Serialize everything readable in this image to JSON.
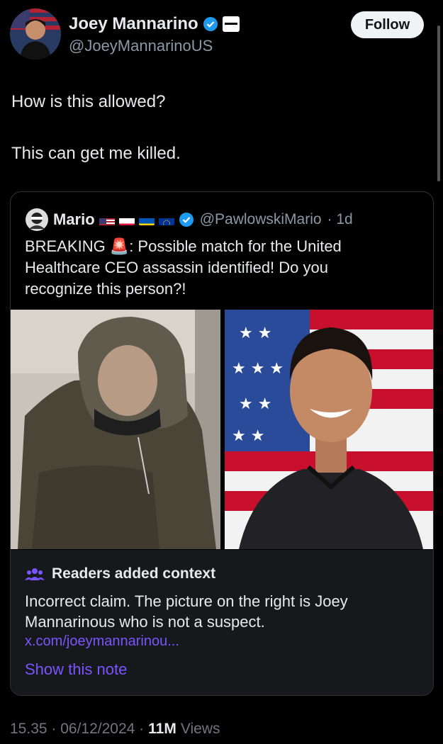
{
  "author": {
    "name": "Joey Mannarino",
    "handle": "@JoeyMannarinoUS",
    "follow_label": "Follow"
  },
  "tweet": {
    "line1": "How is this allowed?",
    "line2": "This can get me killed."
  },
  "quote": {
    "name": "Mario",
    "handle": "@PawlowskiMario",
    "age": "· 1d",
    "text_line1": "BREAKING 🚨: Possible match for the United",
    "text_line2": "Healthcare CEO assassin identified! Do you",
    "text_line3": "recognize this person?!"
  },
  "context": {
    "title": "Readers added context",
    "body_line1": "Incorrect claim. The picture on the right is Joey",
    "body_line2": "Mannarinous who is not a suspect.",
    "link": "x.com/joeymannarinou...",
    "show_note": "Show this note"
  },
  "meta": {
    "time": "15.35 · 06/12/2024 ·",
    "views_count": "11M",
    "views_label": "Views"
  },
  "colors": {
    "background": "#000000",
    "link": "#7856ff",
    "verified": "#1d9bf0"
  }
}
